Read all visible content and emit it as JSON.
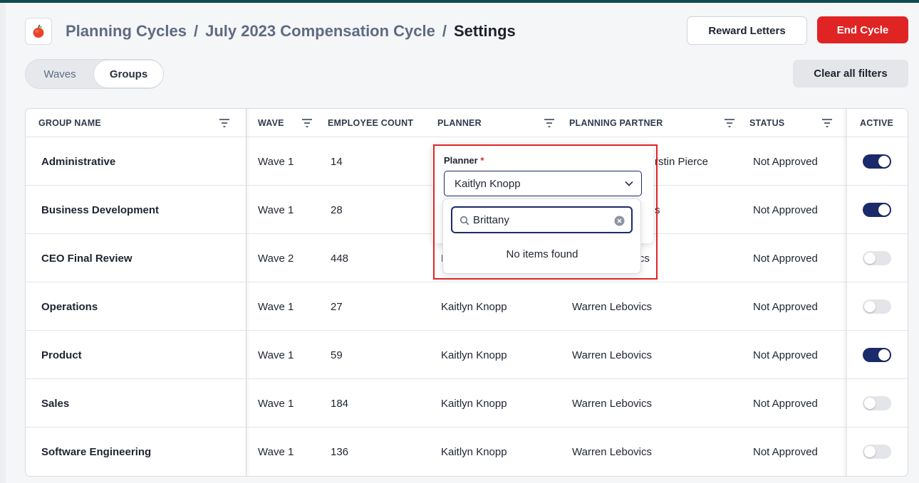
{
  "header": {
    "breadcrumb": [
      "Planning Cycles",
      "July 2023 Compensation Cycle",
      "Settings"
    ],
    "separator": "/",
    "reward_letters_label": "Reward Letters",
    "end_cycle_label": "End Cycle"
  },
  "tabs": {
    "waves": "Waves",
    "groups": "Groups",
    "active": "Groups"
  },
  "clear_filters_label": "Clear all filters",
  "table": {
    "columns": {
      "group_name": "GROUP NAME",
      "wave": "WAVE",
      "employee_count": "EMPLOYEE COUNT",
      "planner": "PLANNER",
      "planning_partner": "PLANNING PARTNER",
      "status": "STATUS",
      "active": "ACTIVE"
    },
    "rows": [
      {
        "group": "Administrative",
        "wave": "Wave 1",
        "count": "14",
        "planner": "",
        "partner": "rstin Pierce",
        "status": "Not Approved",
        "active": true
      },
      {
        "group": "Business Development",
        "wave": "Wave 1",
        "count": "28",
        "planner": "",
        "partner": "s",
        "status": "Not Approved",
        "active": true
      },
      {
        "group": "CEO Final Review",
        "wave": "Wave 2",
        "count": "448",
        "planner": "K",
        "partner": "vics",
        "status": "Not Approved",
        "active": false
      },
      {
        "group": "Operations",
        "wave": "Wave 1",
        "count": "27",
        "planner": "Kaitlyn Knopp",
        "partner": "Warren Lebovics",
        "status": "Not Approved",
        "active": false
      },
      {
        "group": "Product",
        "wave": "Wave 1",
        "count": "59",
        "planner": "Kaitlyn Knopp",
        "partner": "Warren Lebovics",
        "status": "Not Approved",
        "active": true
      },
      {
        "group": "Sales",
        "wave": "Wave 1",
        "count": "184",
        "planner": "Kaitlyn Knopp",
        "partner": "Warren Lebovics",
        "status": "Not Approved",
        "active": false
      },
      {
        "group": "Software Engineering",
        "wave": "Wave 1",
        "count": "136",
        "planner": "Kaitlyn Knopp",
        "partner": "Warren Lebovics",
        "status": "Not Approved",
        "active": false
      }
    ]
  },
  "planner_popover": {
    "label": "Planner",
    "required_mark": "*",
    "selected_value": "Kaitlyn Knopp",
    "search_value": "Brittany",
    "empty_message": "No items found"
  },
  "icons": [
    "apple-logo-icon",
    "filter-icon",
    "chevron-down-icon",
    "search-icon",
    "clear-icon"
  ],
  "colors": {
    "accent": "#1b2a6b",
    "danger": "#e02424",
    "top_bar": "#0e4c4d"
  }
}
